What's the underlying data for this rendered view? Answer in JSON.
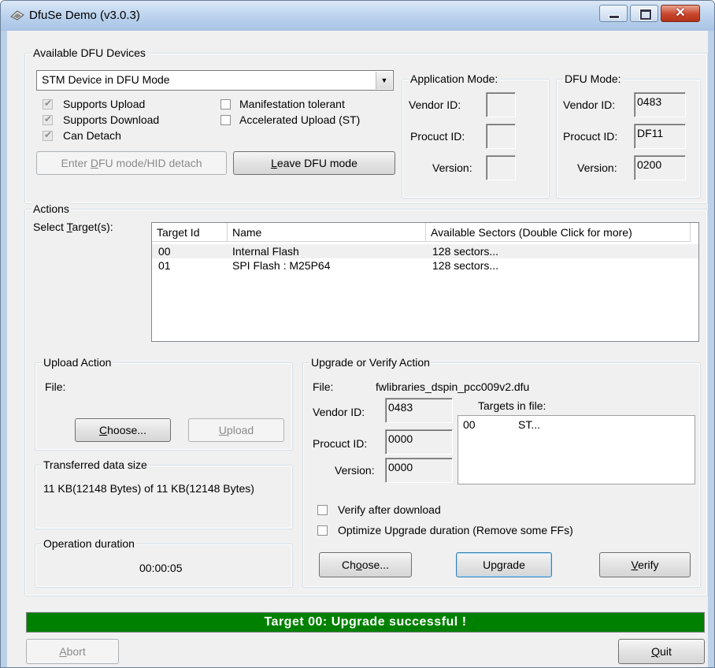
{
  "window": {
    "title": "DfuSe Demo (v3.0.3)"
  },
  "devices": {
    "legend": "Available DFU Devices",
    "selected_device": "STM Device in DFU Mode",
    "checkboxes": [
      {
        "label": "Supports Upload",
        "checked": true
      },
      {
        "label": "Supports Download",
        "checked": true
      },
      {
        "label": "Can Detach",
        "checked": true
      },
      {
        "label": "Manifestation tolerant",
        "checked": false
      },
      {
        "label": "Accelerated Upload (ST)",
        "checked": false
      }
    ],
    "enter_dfu_button": {
      "prefix": "Enter ",
      "accel": "D",
      "suffix": "FU mode/HID detach"
    },
    "leave_dfu_button": {
      "accel": "L",
      "suffix": "eave DFU mode"
    }
  },
  "application_mode": {
    "legend": "Application Mode:",
    "vendor_label": "Vendor ID:",
    "vendor_value": "",
    "product_label": "Procuct ID:",
    "product_value": "",
    "version_label": "Version:",
    "version_value": ""
  },
  "dfu_mode": {
    "legend": "DFU Mode:",
    "vendor_label": "Vendor ID:",
    "vendor_value": "0483",
    "product_label": "Procuct ID:",
    "product_value": "DF11",
    "version_label": "Version:",
    "version_value": "0200"
  },
  "actions": {
    "legend": "Actions",
    "select_target_label": {
      "prefix": "Select ",
      "accel": "T",
      "suffix": "arget(s):"
    },
    "columns": [
      "Target Id",
      "Name",
      "Available Sectors (Double Click for more)"
    ],
    "targets": [
      {
        "id": "00",
        "name": "Internal Flash",
        "sectors": "128 sectors..."
      },
      {
        "id": "01",
        "name": "SPI Flash : M25P64",
        "sectors": "128 sectors..."
      }
    ]
  },
  "upload": {
    "legend": "Upload Action",
    "file_label": "File:",
    "choose_button": {
      "accel": "C",
      "suffix": "hoose..."
    },
    "upload_button": {
      "accel": "U",
      "suffix": "pload"
    }
  },
  "transferred": {
    "legend": "Transferred data size",
    "text": "11 KB(12148 Bytes) of 11 KB(12148 Bytes)"
  },
  "duration": {
    "legend": "Operation duration",
    "value": "00:00:05"
  },
  "upgrade": {
    "legend": "Upgrade or Verify Action",
    "file_label": "File:",
    "file_value": "fwlibraries_dspin_pcc009v2.dfu",
    "vendor_label": "Vendor ID:",
    "vendor_value": "0483",
    "product_label": "Procuct ID:",
    "product_value": "0000",
    "version_label": "Version:",
    "version_value": "0000",
    "targets_label": "Targets in file:",
    "targets_in_file": [
      {
        "id": "00",
        "name": "ST..."
      }
    ],
    "verify_after_download": {
      "label": "Verify after download",
      "checked": false
    },
    "optimize_upgrade": {
      "label": "Optimize Upgrade duration (Remove some FFs)",
      "checked": false
    },
    "choose_button": {
      "prefix": "Ch",
      "accel": "o",
      "suffix": "ose..."
    },
    "upgrade_button": {
      "prefix": "Up",
      "accel": "g",
      "suffix": "rade"
    },
    "verify_button": {
      "accel": "V",
      "suffix": "erify"
    }
  },
  "status": {
    "text": "Target 00: Upgrade successful !",
    "color": "#008000"
  },
  "footer": {
    "abort_button": {
      "accel": "A",
      "suffix": "bort"
    },
    "quit_button": {
      "accel": "Q",
      "suffix": "uit"
    }
  }
}
